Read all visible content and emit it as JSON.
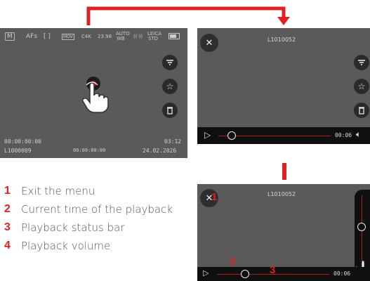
{
  "live_view": {
    "status": {
      "mode": "M",
      "af": "AFs",
      "metering": "[ ]",
      "file_format": "MOV",
      "resolution": "C4K",
      "frame_rate": "23.98",
      "white_balance": "AUTO WB",
      "stabilization": "((·))",
      "film_style": "LEICA STD",
      "battery": "battery"
    },
    "timecode": "00:00:00:00",
    "file_counter": "L1000009",
    "center_timer": "00:00:00:00",
    "remaining": "03:12",
    "date": "24.02.2026"
  },
  "playback_view": {
    "filename": "L1010052",
    "current_time": "00:06",
    "progress": 0.12
  },
  "detail_view": {
    "filename": "L1010052",
    "current_time": "00:06",
    "progress": 0.25,
    "volume_level": 0.55,
    "callouts": [
      "1",
      "2",
      "3",
      "4"
    ]
  },
  "legend": [
    {
      "num": "1",
      "text": "Exit the menu"
    },
    {
      "num": "2",
      "text": "Current time of the playback"
    },
    {
      "num": "3",
      "text": "Playback status bar"
    },
    {
      "num": "4",
      "text": "Playback volume"
    }
  ],
  "colors": {
    "accent": "#e02020",
    "screen": "#5a5a5a",
    "bar": "#0f0f0f"
  },
  "icons": [
    "close-icon",
    "filter-icon",
    "star-icon",
    "trash-icon",
    "play-icon",
    "speaker-icon",
    "tap-hand-icon",
    "record-icon"
  ]
}
